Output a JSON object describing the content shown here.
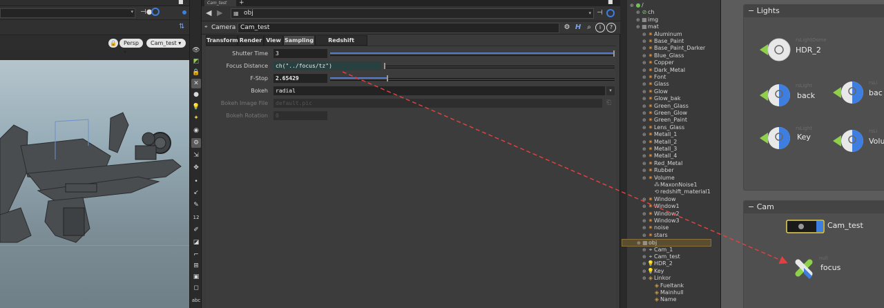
{
  "viewport": {
    "persp_label": "Persp ▾",
    "camera_label": "Cam_test ▾"
  },
  "shelf": {
    "bottom_label": "abc",
    "number_label": "12"
  },
  "params": {
    "tab_label": "Cam_test",
    "path": "obj",
    "node_type": "Camera",
    "node_name": "Cam_test",
    "subtabs": [
      "Transform",
      "Render",
      "View",
      "Sampling",
      "Redshift Camera"
    ],
    "rows": [
      {
        "label": "Shutter Time",
        "value": "3"
      },
      {
        "label": "Focus Distance",
        "value": "ch(\"../focus/tz\")"
      },
      {
        "label": "F-Stop",
        "value": "2.65429"
      },
      {
        "label": "Bokeh",
        "value": "radial"
      },
      {
        "label": "Bokeh Image File",
        "value": "default.pic"
      },
      {
        "label": "Bokeh Rotation",
        "value": "0"
      }
    ],
    "slider_levels": {
      "shutter": 1.0,
      "fstop": 0.2
    }
  },
  "tree": {
    "items": [
      {
        "label": "/",
        "depth": 0,
        "icon": "globe"
      },
      {
        "label": "ch",
        "depth": 1,
        "icon": "ch"
      },
      {
        "label": "img",
        "depth": 1,
        "icon": "img"
      },
      {
        "label": "mat",
        "depth": 1,
        "icon": "mat"
      },
      {
        "label": "Aluminum",
        "depth": 2,
        "icon": "shader"
      },
      {
        "label": "Base_Paint",
        "depth": 2,
        "icon": "shader"
      },
      {
        "label": "Base_Paint_Darker",
        "depth": 2,
        "icon": "shader"
      },
      {
        "label": "Blue_Glass",
        "depth": 2,
        "icon": "shader"
      },
      {
        "label": "Copper",
        "depth": 2,
        "icon": "shader"
      },
      {
        "label": "Dark_Metal",
        "depth": 2,
        "icon": "shader"
      },
      {
        "label": "Font",
        "depth": 2,
        "icon": "shader"
      },
      {
        "label": "Glass",
        "depth": 2,
        "icon": "shader"
      },
      {
        "label": "Glow",
        "depth": 2,
        "icon": "shader"
      },
      {
        "label": "Glow_bak",
        "depth": 2,
        "icon": "shader"
      },
      {
        "label": "Green_Glass",
        "depth": 2,
        "icon": "shader"
      },
      {
        "label": "Green_Glow",
        "depth": 2,
        "icon": "shader"
      },
      {
        "label": "Green_Paint",
        "depth": 2,
        "icon": "shader"
      },
      {
        "label": "Lens_Glass",
        "depth": 2,
        "icon": "shader"
      },
      {
        "label": "Metall_1",
        "depth": 2,
        "icon": "shader"
      },
      {
        "label": "Metall_2",
        "depth": 2,
        "icon": "shader"
      },
      {
        "label": "Metall_3",
        "depth": 2,
        "icon": "shader"
      },
      {
        "label": "Metall_4",
        "depth": 2,
        "icon": "shader"
      },
      {
        "label": "Red_Metal",
        "depth": 2,
        "icon": "shader"
      },
      {
        "label": "Rubber",
        "depth": 2,
        "icon": "shader"
      },
      {
        "label": "Volume",
        "depth": 2,
        "icon": "shader"
      },
      {
        "label": "MaxonNoise1",
        "depth": 3,
        "icon": "noise"
      },
      {
        "label": "redshift_material1",
        "depth": 3,
        "icon": "rsmat"
      },
      {
        "label": "Window",
        "depth": 2,
        "icon": "shader"
      },
      {
        "label": "Window1",
        "depth": 2,
        "icon": "shader"
      },
      {
        "label": "Window2",
        "depth": 2,
        "icon": "shader"
      },
      {
        "label": "Window3",
        "depth": 2,
        "icon": "shader"
      },
      {
        "label": "noise",
        "depth": 2,
        "icon": "shader"
      },
      {
        "label": "stars",
        "depth": 2,
        "icon": "shader"
      },
      {
        "label": "obj",
        "depth": 1,
        "icon": "obj",
        "selected": true
      },
      {
        "label": "Cam_1",
        "depth": 2,
        "icon": "cam"
      },
      {
        "label": "Cam_test",
        "depth": 2,
        "icon": "cam"
      },
      {
        "label": "HDR_2",
        "depth": 2,
        "icon": "light"
      },
      {
        "label": "Key",
        "depth": 2,
        "icon": "light"
      },
      {
        "label": "Linkor",
        "depth": 2,
        "icon": "geo"
      },
      {
        "label": "Fueltank",
        "depth": 3,
        "icon": "geo"
      },
      {
        "label": "Mainhull",
        "depth": 3,
        "icon": "geo"
      },
      {
        "label": "Name",
        "depth": 3,
        "icon": "geo"
      }
    ]
  },
  "network": {
    "lights_box_title": "Lights",
    "cam_box_title": "Cam",
    "nodes": {
      "hdr": "HDR_2",
      "back": "back",
      "back2": "bac",
      "key": "Key",
      "vol": "Volu",
      "cam": "Cam_test",
      "focus": "focus"
    },
    "faint": {
      "hdr": "rsLightDome",
      "back": "rsLight",
      "back2": "rsLi",
      "key": "rsLight",
      "vol": "rsLi",
      "focus": "null"
    }
  },
  "colors": {
    "accent_blue": "#3d7ee0",
    "expr_teal": "#28403f",
    "light_green": "#8fd04a",
    "arrow_red": "#e14040"
  }
}
